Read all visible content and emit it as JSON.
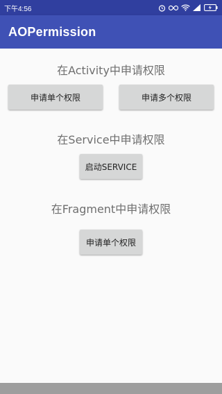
{
  "status_bar": {
    "time": "下午4:56",
    "icons": [
      "alarm-icon",
      "infinity-icon",
      "wifi-icon",
      "signal-icon",
      "battery-charging-icon"
    ]
  },
  "app_bar": {
    "title": "AOPermission"
  },
  "sections": {
    "activity": {
      "label": "在Activity中申请权限",
      "single_button": "申请单个权限",
      "multiple_button": "申请多个权限"
    },
    "service": {
      "label": "在Service中申请权限",
      "start_button": "启动SERVICE"
    },
    "fragment": {
      "label": "在Fragment中申请权限",
      "single_button": "申请单个权限"
    }
  },
  "colors": {
    "status_bar": "#303f9f",
    "app_bar": "#3f51b5",
    "button_bg": "#d6d7d7",
    "label_text": "#6f6f6f"
  }
}
